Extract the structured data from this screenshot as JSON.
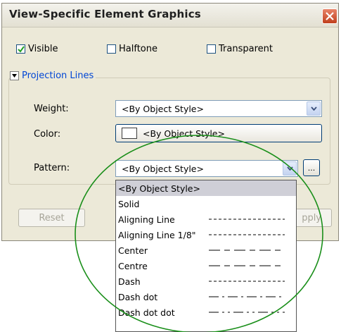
{
  "dialog": {
    "title": "View-Specific Element Graphics",
    "checkboxes": [
      {
        "label": "Visible",
        "checked": true
      },
      {
        "label": "Halftone",
        "checked": false
      },
      {
        "label": "Transparent",
        "checked": false
      }
    ]
  },
  "group": {
    "title": "Projection Lines",
    "weight": {
      "label": "Weight:",
      "value": "<By Object Style>"
    },
    "color": {
      "label": "Color:",
      "value": "<By Object Style>"
    },
    "pattern": {
      "label": "Pattern:",
      "value": "<By Object Style>"
    }
  },
  "buttons": {
    "reset": "Reset",
    "apply_partial": "pply"
  },
  "pattern_options": [
    {
      "name": "<By Object Style>",
      "pattern": "none",
      "selected": true
    },
    {
      "name": "Solid",
      "pattern": "none"
    },
    {
      "name": "Aligning Line",
      "pattern": "dashed-fine"
    },
    {
      "name": "Aligning Line 1/8\"",
      "pattern": "dashed-fine"
    },
    {
      "name": "Center",
      "pattern": "center"
    },
    {
      "name": "Centre",
      "pattern": "center"
    },
    {
      "name": "Dash",
      "pattern": "dashed-fine"
    },
    {
      "name": "Dash dot",
      "pattern": "dash-dot"
    },
    {
      "name": "Dash dot dot",
      "pattern": "dash-dot-dot"
    }
  ],
  "highlight_color": "#1a8f1a"
}
